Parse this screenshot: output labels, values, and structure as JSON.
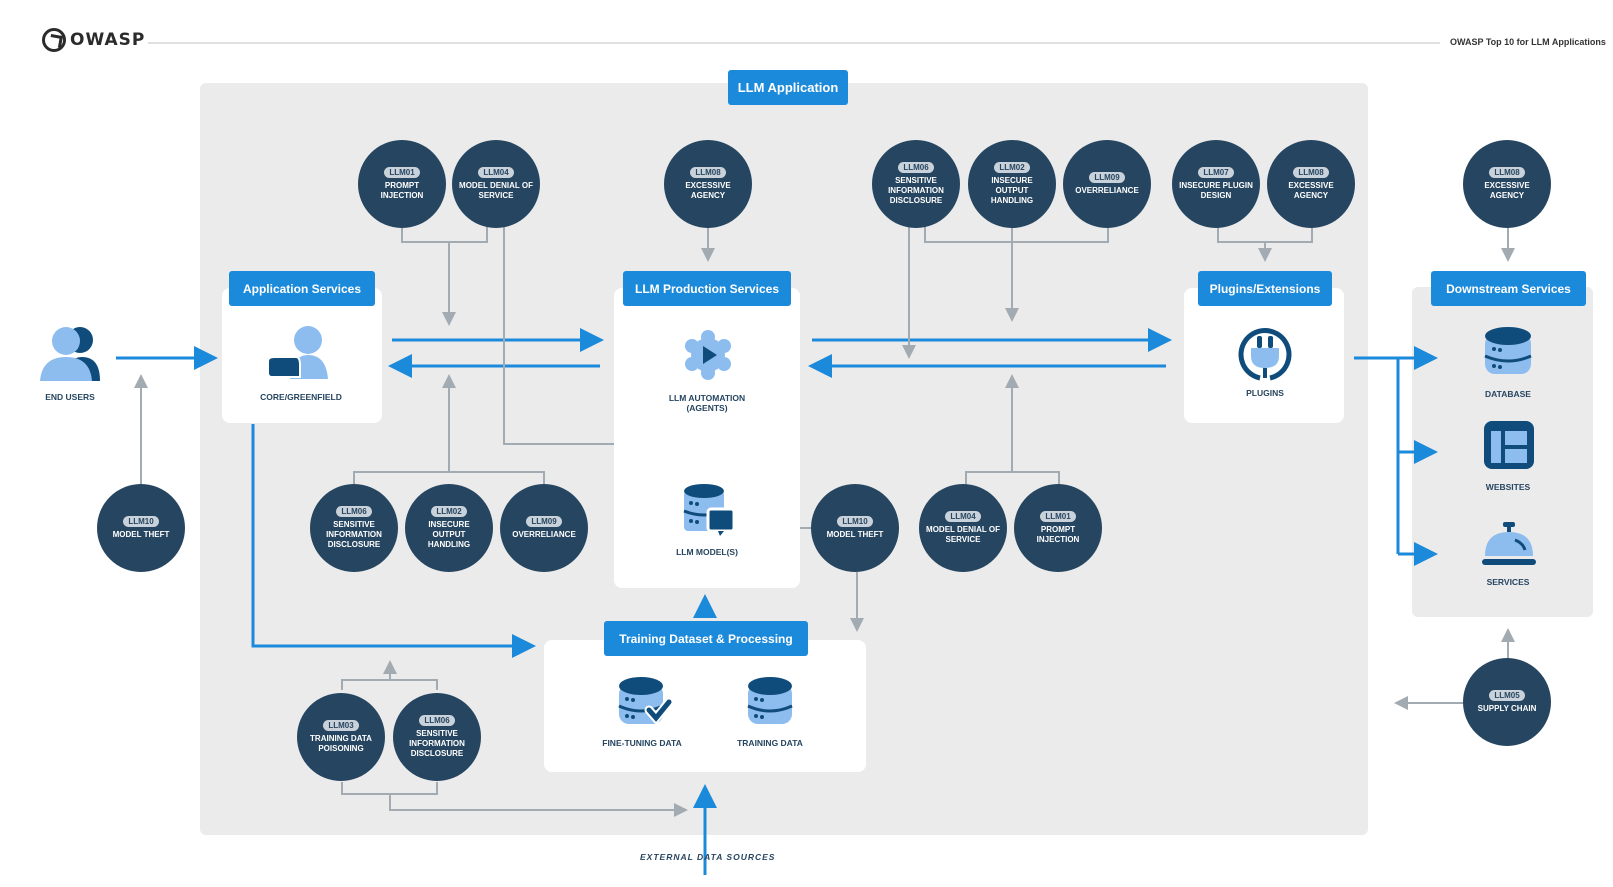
{
  "header": {
    "logo_text": "OWASP",
    "title": "OWASP Top 10 for LLM Applications"
  },
  "colors": {
    "accent_blue": "#1c8adb",
    "risk_navy": "#264560",
    "connector_gray": "#a3abb2",
    "panel_gray": "#ebebeb"
  },
  "zones": {
    "llm_application": "LLM Application",
    "application_services": "Application Services",
    "llm_production_services": "LLM Production Services",
    "plugins_extensions": "Plugins/Extensions",
    "downstream_services": "Downstream Services",
    "training_dataset": "Training Dataset & Processing"
  },
  "components": {
    "end_users": "END USERS",
    "core_greenfield": "CORE/GREENFIELD",
    "llm_automation": "LLM AUTOMATION (AGENTS)",
    "llm_models": "LLM MODEL(S)",
    "plugins": "PLUGINS",
    "database": "DATABASE",
    "websites": "WEBSITES",
    "services": "SERVICES",
    "fine_tuning_data": "FINE-TUNING DATA",
    "training_data": "TRAINING DATA",
    "external_data_sources": "EXTERNAL DATA SOURCES"
  },
  "risks": [
    {
      "id": "LLM01",
      "name": "PROMPT INJECTION"
    },
    {
      "id": "LLM04",
      "name": "MODEL DENIAL OF SERVICE"
    },
    {
      "id": "LLM08",
      "name": "EXCESSIVE AGENCY"
    },
    {
      "id": "LLM06",
      "name": "SENSITIVE INFORMATION DISCLOSURE"
    },
    {
      "id": "LLM02",
      "name": "INSECURE OUTPUT HANDLING"
    },
    {
      "id": "LLM09",
      "name": "OVERRELIANCE"
    },
    {
      "id": "LLM07",
      "name": "INSECURE PLUGIN DESIGN"
    },
    {
      "id": "LLM08",
      "name": "EXCESSIVE AGENCY"
    },
    {
      "id": "LLM08",
      "name": "EXCESSIVE AGENCY"
    },
    {
      "id": "LLM10",
      "name": "MODEL THEFT"
    },
    {
      "id": "LLM06",
      "name": "SENSITIVE INFORMATION DISCLOSURE"
    },
    {
      "id": "LLM02",
      "name": "INSECURE OUTPUT HANDLING"
    },
    {
      "id": "LLM09",
      "name": "OVERRELIANCE"
    },
    {
      "id": "LLM10",
      "name": "MODEL THEFT"
    },
    {
      "id": "LLM04",
      "name": "MODEL DENIAL OF SERVICE"
    },
    {
      "id": "LLM01",
      "name": "PROMPT INJECTION"
    },
    {
      "id": "LLM03",
      "name": "TRAINING DATA POISONING"
    },
    {
      "id": "LLM06",
      "name": "SENSITIVE INFORMATION DISCLOSURE"
    },
    {
      "id": "LLM05",
      "name": "SUPPLY CHAIN"
    }
  ]
}
